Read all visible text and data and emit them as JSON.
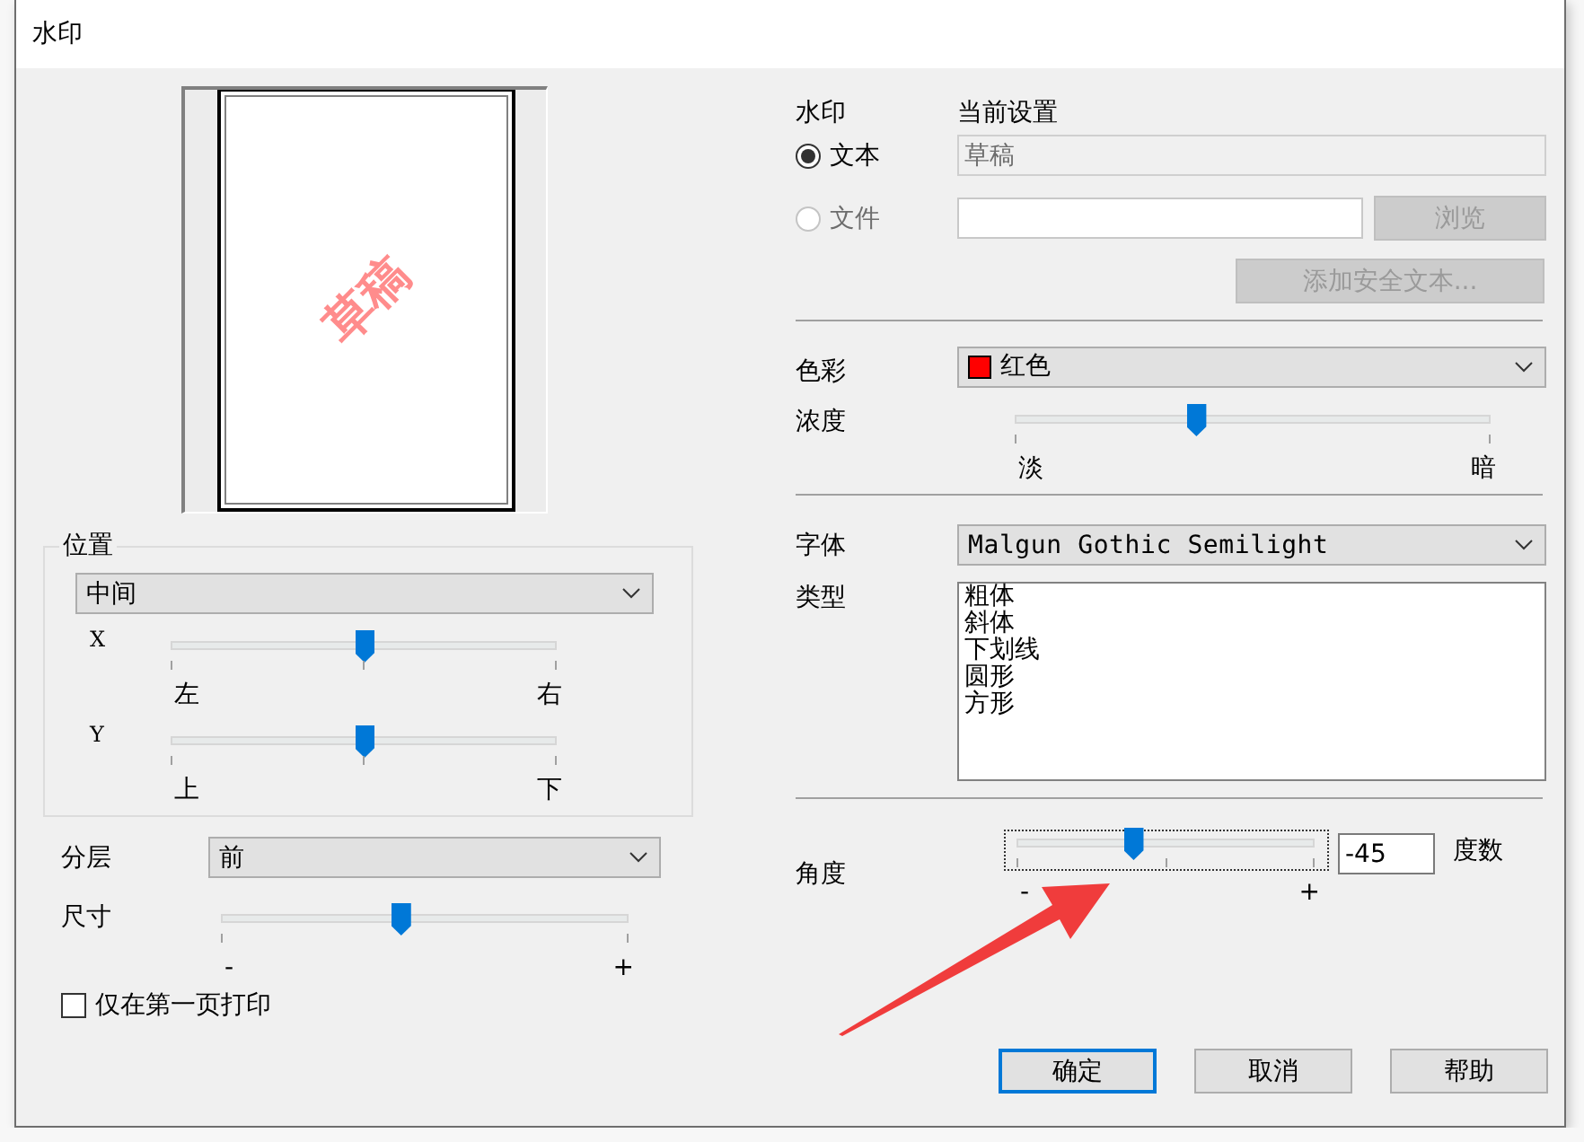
{
  "window": {
    "title": "水印"
  },
  "preview": {
    "watermark_text": "草稿"
  },
  "position": {
    "label": "位置",
    "dropdown": "中间",
    "x": {
      "label": "X",
      "level": 0.5,
      "min_label": "左",
      "max_label": "右"
    },
    "y": {
      "label": "Y",
      "level": 0.5,
      "min_label": "上",
      "max_label": "下"
    }
  },
  "layer": {
    "label": "分层",
    "value": "前"
  },
  "size": {
    "label": "尺寸",
    "level": 0.44,
    "min_label": "-",
    "max_label": "+"
  },
  "first_page_only": {
    "label": "仅在第一页打印",
    "checked": false
  },
  "watermark": {
    "label": "水印",
    "current_label": "当前设置",
    "sources": [
      {
        "label": "文本",
        "selected": true,
        "disabled": false,
        "value": "草稿"
      },
      {
        "label": "文件",
        "selected": false,
        "disabled": true
      }
    ]
  },
  "browse_button": {
    "label": "浏览",
    "disabled": true
  },
  "add_secure_text_button": {
    "label": "添加安全文本...",
    "disabled": true
  },
  "color": {
    "label": "色彩",
    "value": "红色",
    "color": "#ff0000"
  },
  "density": {
    "label": "浓度",
    "level": 0.38,
    "min_label": "淡",
    "max_label": "暗"
  },
  "font": {
    "label": "字体",
    "value": "Malgun Gothic Semilight"
  },
  "style": {
    "label": "类型",
    "options": [
      "粗体",
      "斜体",
      "下划线",
      "圆形",
      "方形"
    ]
  },
  "angle": {
    "label": "角度",
    "level": 0.39,
    "value": "-45",
    "unit": "度数",
    "min_label": "-",
    "max_label": "+"
  },
  "buttons": [
    {
      "label": "确定",
      "default": true
    },
    {
      "label": "取消",
      "default": false
    },
    {
      "label": "帮助",
      "default": false
    }
  ]
}
